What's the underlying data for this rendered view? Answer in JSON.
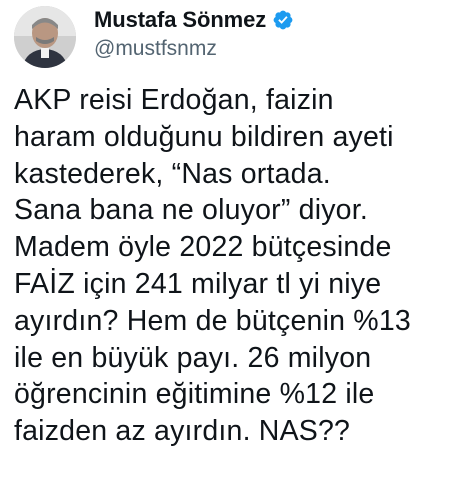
{
  "author": {
    "display_name": "Mustafa Sönmez",
    "handle": "@mustfsnmz",
    "verified": true,
    "avatar_icon": "profile-photo",
    "verified_icon": "verified-badge-icon"
  },
  "tweet": {
    "lines": [
      "AKP reisi Erdoğan, faizin",
      "haram olduğunu bildiren ayeti",
      "kastederek, “Nas ortada.",
      "Sana bana ne oluyor” diyor.",
      "Madem öyle 2022 bütçesinde",
      "FAİZ için 241 milyar tl yi niye",
      "ayırdın? Hem de bütçenin %13",
      "ile en büyük payı. 26 milyon",
      "öğrencinin eğitimine %12 ile",
      "faizden az ayırdın. NAS??"
    ]
  },
  "colors": {
    "text_primary": "#0f1419",
    "text_secondary": "#536471",
    "verified_blue": "#1d9bf0",
    "background": "#ffffff"
  }
}
